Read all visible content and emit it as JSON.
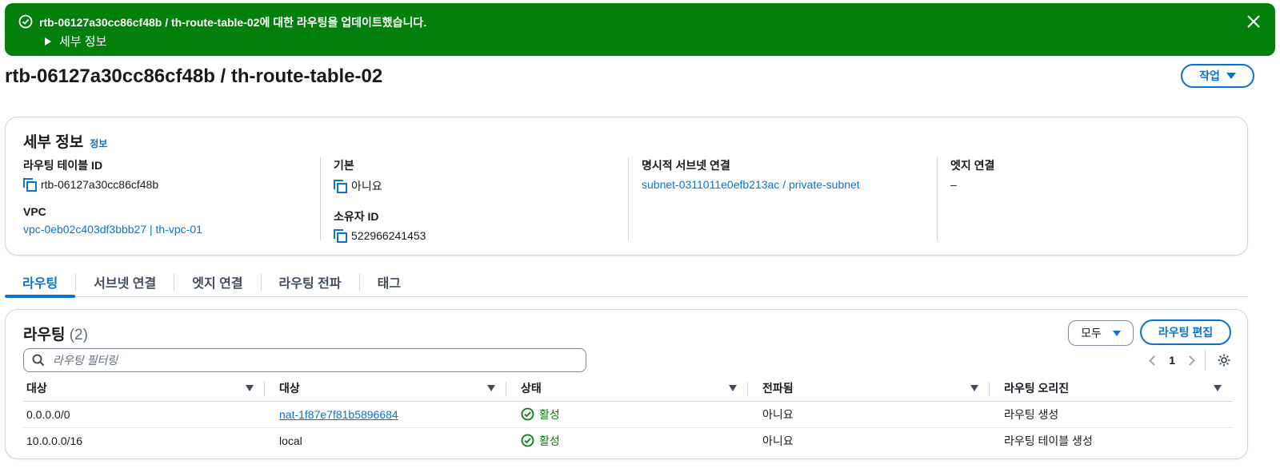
{
  "flash": {
    "message": "rtb-06127a30cc86cf48b / th-route-table-02에 대한 라우팅을 업데이트했습니다.",
    "details_label": "세부 정보",
    "icons": [
      "success-check-icon",
      "close-icon",
      "caret-right-icon"
    ],
    "color": "#037f0c"
  },
  "header": {
    "title": "rtb-06127a30cc86cf48b / th-route-table-02",
    "actions_label": "작업"
  },
  "details": {
    "title": "세부 정보",
    "info_link": "정보",
    "route_table_id_label": "라우팅 테이블 ID",
    "route_table_id_value": "rtb-06127a30cc86cf48b",
    "vpc_label": "VPC",
    "vpc_value": "vpc-0eb02c403df3bbb27 | th-vpc-01",
    "main_label": "기본",
    "main_value": "아니요",
    "owner_label": "소유자 ID",
    "owner_value": "522966241453",
    "explicit_subnet_label": "명시적 서브넷 연결",
    "explicit_subnet_value": "subnet-0311011e0efb213ac / private-subnet",
    "edge_label": "엣지 연결",
    "edge_value": "–"
  },
  "tabs": [
    {
      "label": "라우팅",
      "active": true
    },
    {
      "label": "서브넷 연결"
    },
    {
      "label": "엣지 연결"
    },
    {
      "label": "라우팅 전파"
    },
    {
      "label": "태그"
    }
  ],
  "routes": {
    "title": "라우팅",
    "count": "(2)",
    "filter_label": "모두",
    "edit_label": "라우팅 편집",
    "search_placeholder": "라우팅 필터링",
    "page": "1",
    "columns": [
      "대상",
      "대상",
      "상태",
      "전파됨",
      "라우팅 오리진"
    ],
    "rows": [
      {
        "destination": "0.0.0.0/0",
        "target": "nat-1f87e7f81b5896684",
        "status": "활성",
        "propagated": "아니요",
        "origin": "라우팅 생성"
      },
      {
        "destination": "10.0.0.0/16",
        "target": "local",
        "status": "활성",
        "propagated": "아니요",
        "origin": "라우팅 테이블 생성"
      }
    ]
  },
  "colors": {
    "accent": "#0972d3",
    "success": "#037f0c",
    "text": "#16191f",
    "border": "#d1d5db"
  }
}
